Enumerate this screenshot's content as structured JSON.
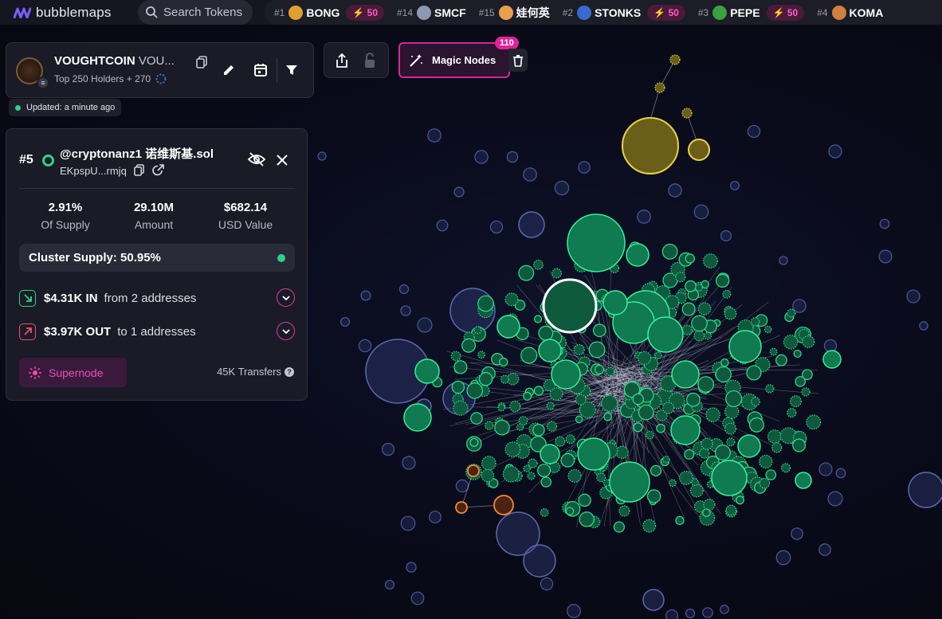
{
  "app": {
    "brand": "bubblemaps",
    "search_placeholder": "Search Tokens"
  },
  "tickers": [
    {
      "rank": "#1",
      "name": "BONG",
      "boost": "50",
      "logo_color": "#e0a030"
    },
    {
      "rank": "#14",
      "name": "SMCF",
      "boost": "",
      "logo_color": "#8c9ab0"
    },
    {
      "rank": "#15",
      "name": "娃何英",
      "boost": "",
      "logo_color": "#e8a050"
    },
    {
      "rank": "#2",
      "name": "STONKS",
      "boost": "50",
      "logo_color": "#3a6ad0"
    },
    {
      "rank": "#3",
      "name": "PEPE",
      "boost": "50",
      "logo_color": "#3aa040"
    },
    {
      "rank": "#4",
      "name": "KOMA",
      "boost": "",
      "logo_color": "#d08040"
    }
  ],
  "token": {
    "name": "VOUGHTCOIN",
    "symbol": "VOU...",
    "subtitle": "Top 250 Holders + 270",
    "updated": "Updated: a minute ago"
  },
  "magic": {
    "label": "Magic Nodes",
    "count": "110"
  },
  "holder": {
    "rank": "#5",
    "name": "@cryptonanz1 诺维斯基.sol",
    "address": "EKpspU...rmjq",
    "stats": [
      {
        "value": "2.91%",
        "label": "Of Supply"
      },
      {
        "value": "29.10M",
        "label": "Amount"
      },
      {
        "value": "$682.14",
        "label": "USD Value"
      }
    ],
    "cluster_supply": "Cluster Supply: 50.95%",
    "in_amount": "$4.31K IN",
    "in_text": "from 2 addresses",
    "out_amount": "$3.97K OUT",
    "out_text": "to 1 addresses",
    "supernode_label": "Supernode",
    "transfers": "45K Transfers"
  },
  "colors": {
    "accent": "#d6259a",
    "green": "#2ed18a",
    "yellow": "#e8d24a",
    "orange": "#f08a3a",
    "blue_node": "#3a4680"
  }
}
